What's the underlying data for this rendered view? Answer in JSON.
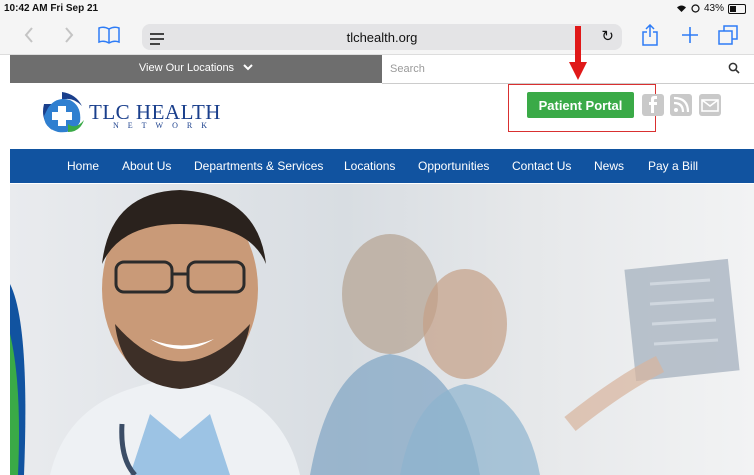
{
  "status": {
    "time": "10:42 AM  Fri Sep 21",
    "battery": "43%"
  },
  "browser": {
    "url": "tlchealth.org"
  },
  "topbar": {
    "locations_label": "View Our Locations",
    "search_placeholder": "Search"
  },
  "logo": {
    "name": "TLC HEALTH",
    "subtitle": "NETWORK"
  },
  "header": {
    "portal_label": "Patient Portal"
  },
  "nav": {
    "items": [
      "Home",
      "About Us",
      "Departments & Services",
      "Locations",
      "Opportunities",
      "Contact Us",
      "News",
      "Pay a Bill"
    ]
  },
  "colors": {
    "brand_blue": "#1153a0",
    "portal_green": "#3aaa47",
    "topbar_grey": "#6e6e6e",
    "annotation_red": "#d93030",
    "ios_blue": "#2e7cf6"
  },
  "icons": [
    "back-icon",
    "forward-icon",
    "bookmarks-icon",
    "reader-icon",
    "reload-icon",
    "share-icon",
    "plus-icon",
    "tabs-icon",
    "chevron-down-icon",
    "search-icon",
    "facebook-icon",
    "rss-icon",
    "mail-icon",
    "wifi-icon",
    "battery-icon",
    "arrow-down-icon"
  ]
}
